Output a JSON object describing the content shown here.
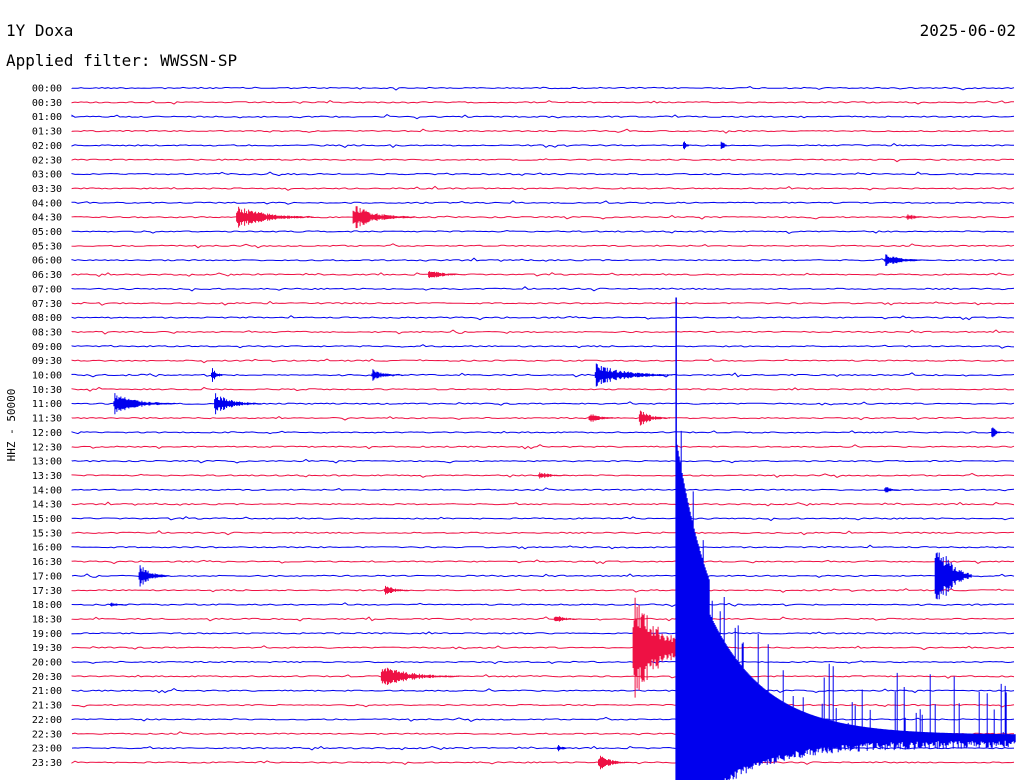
{
  "station": "1Y Doxa",
  "date": "2025-06-02",
  "filter_label": "Applied filter: WWSSN-SP",
  "channel_label": "HHZ - 50000",
  "colors": {
    "blue": "#0000ee",
    "red": "#ee1144",
    "text": "#000000"
  },
  "chart_data": {
    "type": "line",
    "ylabel": "HHZ - 50000",
    "tick_labels": [
      "00:00",
      "00:30",
      "01:00",
      "01:30",
      "02:00",
      "02:30",
      "03:00",
      "03:30",
      "04:00",
      "04:30",
      "05:00",
      "05:30",
      "06:00",
      "06:30",
      "07:00",
      "07:30",
      "08:00",
      "08:30",
      "09:00",
      "09:30",
      "10:00",
      "10:30",
      "11:00",
      "11:30",
      "12:00",
      "12:30",
      "13:00",
      "13:30",
      "14:00",
      "14:30",
      "15:00",
      "15:30",
      "16:00",
      "16:30",
      "17:00",
      "17:30",
      "18:00",
      "18:30",
      "19:00",
      "19:30",
      "20:00",
      "20:30",
      "21:00",
      "21:30",
      "22:00",
      "22:30",
      "23:00",
      "23:30"
    ],
    "row_colors": [
      "blue",
      "red"
    ],
    "trace_minutes": 30,
    "events": [
      {
        "row": 4,
        "minute": 19.4,
        "amp": 16,
        "dur": 0.2
      },
      {
        "row": 4,
        "minute": 20.6,
        "amp": 14,
        "dur": 0.2
      },
      {
        "row": 9,
        "minute": 5.2,
        "amp": 13,
        "dur": 2.5
      },
      {
        "row": 9,
        "minute": 8.9,
        "amp": 14,
        "dur": 2.0
      },
      {
        "row": 9,
        "minute": 26.5,
        "amp": 6,
        "dur": 0.6
      },
      {
        "row": 12,
        "minute": 25.8,
        "amp": 7,
        "dur": 1.5
      },
      {
        "row": 13,
        "minute": 11.3,
        "amp": 6,
        "dur": 1.2
      },
      {
        "row": 20,
        "minute": 4.4,
        "amp": 12,
        "dur": 0.4
      },
      {
        "row": 20,
        "minute": 9.5,
        "amp": 8,
        "dur": 1.0
      },
      {
        "row": 20,
        "minute": 16.6,
        "amp": 13,
        "dur": 2.5
      },
      {
        "row": 22,
        "minute": 1.3,
        "amp": 12,
        "dur": 2.0
      },
      {
        "row": 22,
        "minute": 4.5,
        "amp": 12,
        "dur": 1.5
      },
      {
        "row": 23,
        "minute": 16.4,
        "amp": 6,
        "dur": 1.0
      },
      {
        "row": 23,
        "minute": 18.0,
        "amp": 10,
        "dur": 1.0
      },
      {
        "row": 24,
        "minute": 29.2,
        "amp": 14,
        "dur": 0.3
      },
      {
        "row": 27,
        "minute": 14.8,
        "amp": 5,
        "dur": 1.0
      },
      {
        "row": 28,
        "minute": 25.8,
        "amp": 6,
        "dur": 0.5
      },
      {
        "row": 34,
        "minute": 2.1,
        "amp": 14,
        "dur": 1.0
      },
      {
        "row": 34,
        "minute": 27.4,
        "amp": 52,
        "dur": 1.2
      },
      {
        "row": 35,
        "minute": 9.9,
        "amp": 8,
        "dur": 0.8
      },
      {
        "row": 36,
        "minute": 1.2,
        "amp": 4,
        "dur": 0.6
      },
      {
        "row": 37,
        "minute": 15.3,
        "amp": 6,
        "dur": 0.8
      },
      {
        "row": 39,
        "minute": 17.8,
        "amp": 60,
        "dur": 2.4
      },
      {
        "row": 41,
        "minute": 9.8,
        "amp": 12,
        "dur": 2.5
      },
      {
        "row": 46,
        "minute": 15.4,
        "amp": 5,
        "dur": 0.5
      },
      {
        "row": 47,
        "minute": 16.7,
        "amp": 10,
        "dur": 1.0
      },
      {
        "row": 44,
        "minute": 19.2,
        "amp": 440,
        "dur": 0.05,
        "up_only": true,
        "note": "major quake onset spanning rows"
      }
    ]
  }
}
